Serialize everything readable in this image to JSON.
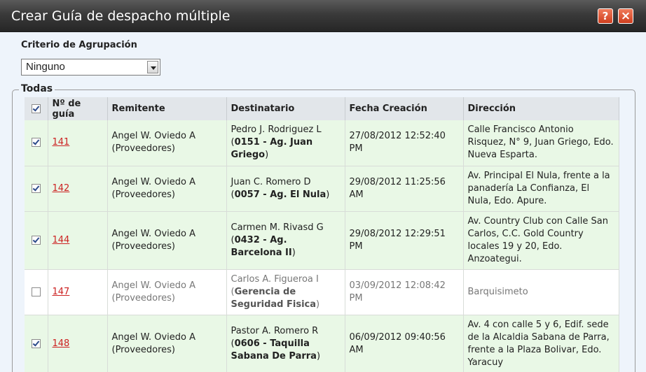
{
  "dialog": {
    "title": "Crear Guía de despacho múltiple",
    "help_icon": "help-icon",
    "close_icon": "close-icon",
    "accent": "#e25a36"
  },
  "grouping": {
    "label": "Criterio de Agrupación",
    "selected": "Ninguno"
  },
  "fieldset_legend": "Todas",
  "table": {
    "headers": [
      "Nº de guía",
      "Remitente",
      "Destinatario",
      "Fecha Creación",
      "Dirección"
    ],
    "rows": [
      {
        "checked": true,
        "guia": "141",
        "remitente_name": "Angel W. Oviedo A",
        "remitente_group": "(Proveedores)",
        "dest_name": "Pedro J. Rodriguez L",
        "dest_open": "(",
        "dest_agency": "0151 - Ag. Juan Griego",
        "dest_close": ")",
        "fecha": "27/08/2012 12:52:40 PM",
        "direccion": "Calle Francisco Antonio Risquez, N° 9, Juan Griego, Edo. Nueva Esparta."
      },
      {
        "checked": true,
        "guia": "142",
        "remitente_name": "Angel W. Oviedo A",
        "remitente_group": "(Proveedores)",
        "dest_name": "Juan C. Romero D",
        "dest_open": "(",
        "dest_agency": "0057 - Ag. El Nula",
        "dest_close": ")",
        "fecha": "29/08/2012 11:25:56 AM",
        "direccion": "Av. Principal El Nula, frente a la panadería La Confianza, El Nula, Edo. Apure."
      },
      {
        "checked": true,
        "guia": "144",
        "remitente_name": "Angel W. Oviedo A",
        "remitente_group": "(Proveedores)",
        "dest_name": "Carmen M. Rivasd G",
        "dest_open": "(",
        "dest_agency": "0432 - Ag. Barcelona II",
        "dest_close": ")",
        "fecha": "29/08/2012 12:29:51 PM",
        "direccion": "Av. Country Club con Calle San Carlos, C.C. Gold Country locales 19 y 20, Edo. Anzoategui."
      },
      {
        "checked": false,
        "guia": "147",
        "remitente_name": "Angel W. Oviedo A",
        "remitente_group": "(Proveedores)",
        "dest_name": "Carlos A. Figueroa I",
        "dest_open": "(",
        "dest_agency": "Gerencia de Seguridad Fisica",
        "dest_close": ")",
        "fecha": "03/09/2012 12:08:42 PM",
        "direccion": "Barquisimeto"
      },
      {
        "checked": true,
        "guia": "148",
        "remitente_name": "Angel W. Oviedo A",
        "remitente_group": "(Proveedores)",
        "dest_name": "Pastor A. Romero R",
        "dest_open": "(",
        "dest_agency": "0606 - Taquilla Sabana De Parra",
        "dest_close": ")",
        "fecha": "06/09/2012 09:40:56 AM",
        "direccion": "Av. 4 con calle 5 y 6, Edif. sede de la Alcaldia Sabana de Parra, frente a la Plaza Bolivar, Edo. Yaracuy"
      }
    ]
  }
}
